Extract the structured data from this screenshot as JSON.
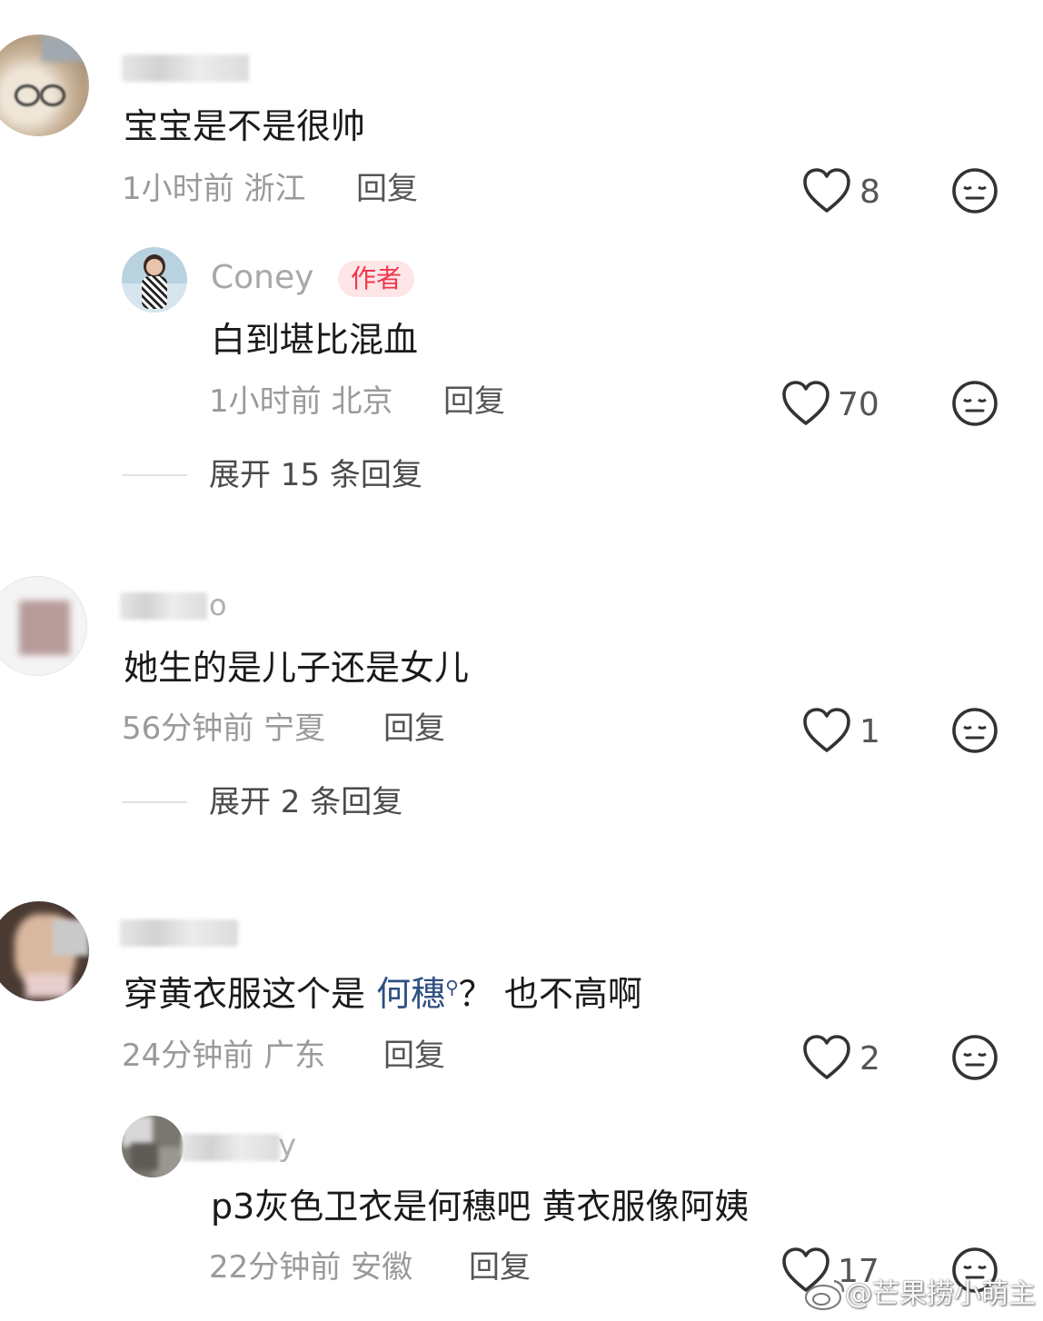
{
  "comments": [
    {
      "text": "宝宝是不是很帅",
      "time": "1小时前",
      "location": "浙江",
      "reply_label": "回复",
      "likes": "8",
      "replies": [
        {
          "author": "Coney",
          "badge": "作者",
          "text": "白到堪比混血",
          "time": "1小时前",
          "location": "北京",
          "reply_label": "回复",
          "likes": "70"
        }
      ],
      "expand_label": "展开 15 条回复"
    },
    {
      "name_suffix": "o",
      "text": "她生的是儿子还是女儿",
      "time": "56分钟前",
      "location": "宁夏",
      "reply_label": "回复",
      "likes": "1",
      "expand_label": "展开 2 条回复"
    },
    {
      "text_before": "穿黄衣服这个是 ",
      "text_link": "何穗",
      "text_after": "？ 也不高啊",
      "time": "24分钟前",
      "location": "广东",
      "reply_label": "回复",
      "likes": "2",
      "replies": [
        {
          "name_suffix": "y",
          "text": "p3灰色卫衣是何穗吧 黄衣服像阿姨",
          "time": "22分钟前",
          "location": "安徽",
          "reply_label": "回复",
          "likes": "17"
        }
      ]
    }
  ],
  "watermark": "@芒果捞小萌主",
  "colors": {
    "meta": "#9a9a9a",
    "badge_text": "#f0364b",
    "badge_bg": "#fde5e8",
    "link": "#2f4f83"
  }
}
